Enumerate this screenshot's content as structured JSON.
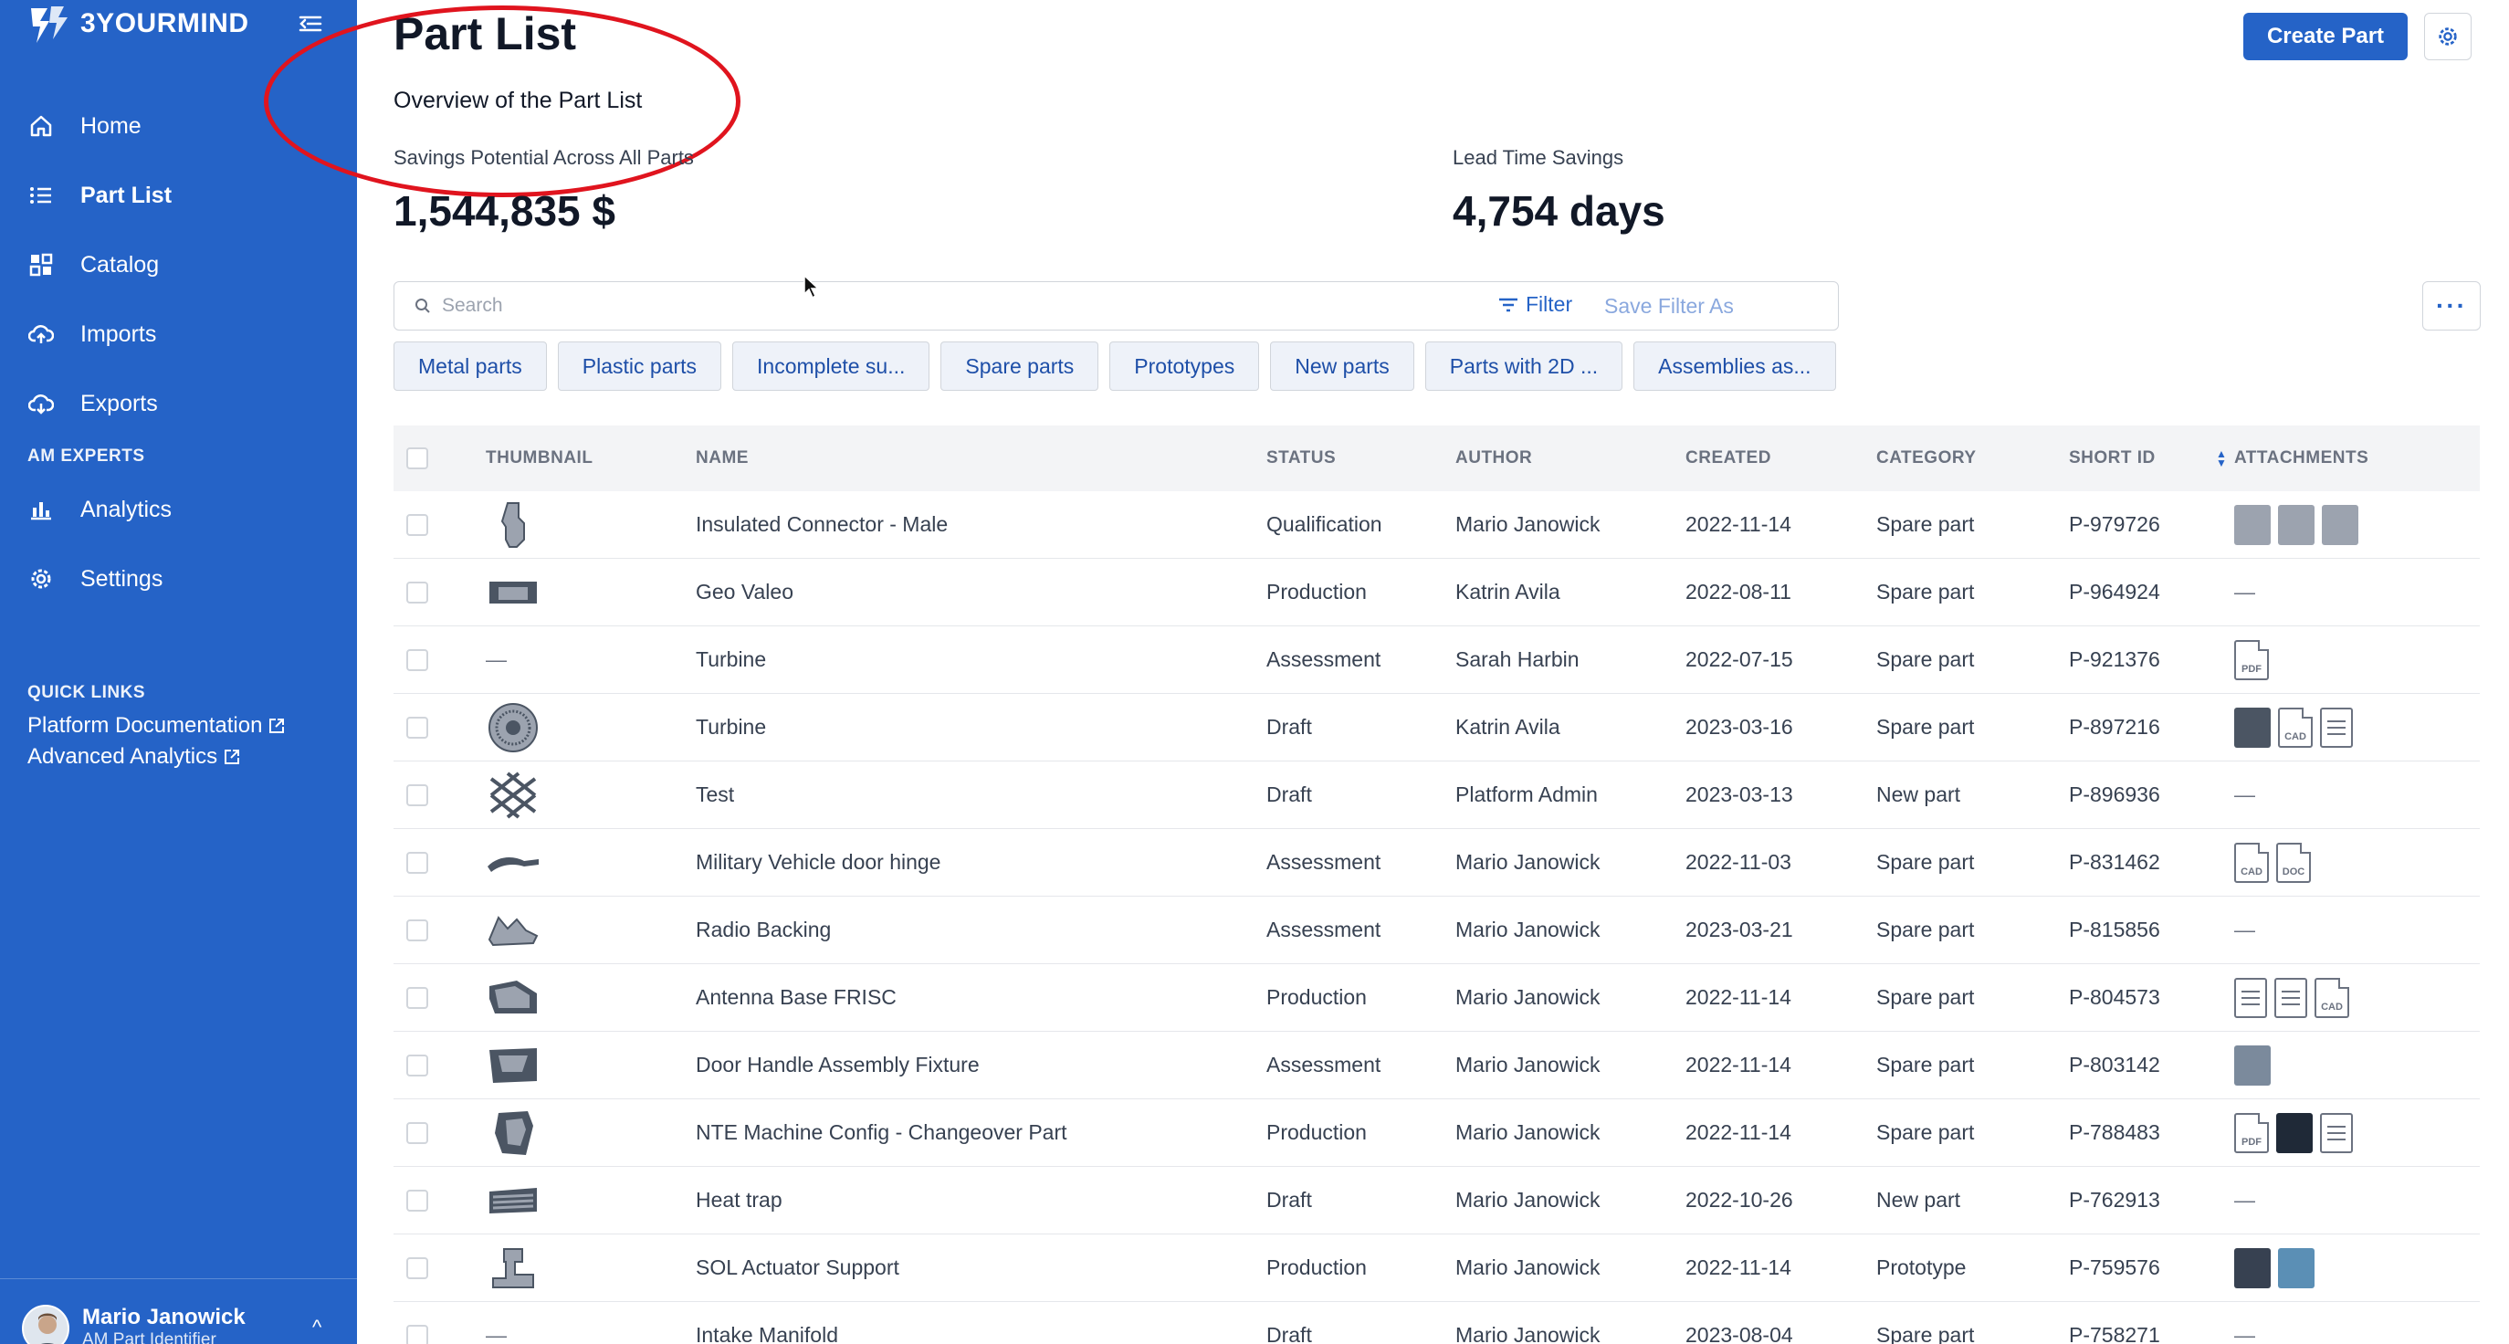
{
  "brand": {
    "name": "3YOURMIND"
  },
  "sidebar": {
    "items": [
      {
        "label": "Home",
        "icon": "home-icon"
      },
      {
        "label": "Part List",
        "icon": "list-icon",
        "active": true
      },
      {
        "label": "Catalog",
        "icon": "catalog-icon"
      },
      {
        "label": "Imports",
        "icon": "cloud-upload-icon"
      },
      {
        "label": "Exports",
        "icon": "cloud-download-icon"
      }
    ],
    "section_label": "AM EXPERTS",
    "expert_items": [
      {
        "label": "Analytics",
        "icon": "bar-chart-icon"
      },
      {
        "label": "Settings",
        "icon": "gear-icon"
      }
    ],
    "quick_links": {
      "title": "QUICK LINKS",
      "links": [
        "Platform Documentation",
        "Advanced Analytics"
      ]
    },
    "user": {
      "name": "Mario Janowick",
      "subtitle": "AM Part Identifier"
    }
  },
  "header": {
    "title": "Part List",
    "subtitle": "Overview of the Part List",
    "create_label": "Create Part"
  },
  "kpis": {
    "savings_label": "Savings Potential Across All Parts",
    "savings_value": "1,544,835 $",
    "lead_label": "Lead Time Savings",
    "lead_value": "4,754 days"
  },
  "search": {
    "placeholder": "Search"
  },
  "toolbar": {
    "filter_label": "Filter",
    "save_filter_label": "Save Filter As",
    "more_label": "···"
  },
  "chips": [
    "Metal parts",
    "Plastic parts",
    "Incomplete su...",
    "Spare parts",
    "Prototypes",
    "New parts",
    "Parts with 2D ...",
    "Assemblies as..."
  ],
  "table": {
    "columns": [
      "THUMBNAIL",
      "NAME",
      "STATUS",
      "AUTHOR",
      "CREATED",
      "CATEGORY",
      "SHORT ID",
      "ATTACHMENTS"
    ],
    "rows": [
      {
        "name": "Insulated Connector - Male",
        "status": "Qualification",
        "author": "Mario Janowick",
        "created": "2022-11-14",
        "category": "Spare part",
        "short_id": "P-979726",
        "thumb": "connector",
        "attachments": [
          "img-gray",
          "img-gray",
          "img-gray"
        ]
      },
      {
        "name": "Geo Valeo",
        "status": "Production",
        "author": "Katrin Avila",
        "created": "2022-08-11",
        "category": "Spare part",
        "short_id": "P-964924",
        "thumb": "block",
        "attachments": []
      },
      {
        "name": "Turbine",
        "status": "Assessment",
        "author": "Sarah Harbin",
        "created": "2022-07-15",
        "category": "Spare part",
        "short_id": "P-921376",
        "thumb": "none",
        "attachments": [
          "PDF"
        ]
      },
      {
        "name": "Turbine",
        "status": "Draft",
        "author": "Katrin Avila",
        "created": "2023-03-16",
        "category": "Spare part",
        "short_id": "P-897216",
        "thumb": "turbine",
        "attachments": [
          "img-dark",
          "CAD",
          "doc"
        ]
      },
      {
        "name": "Test",
        "status": "Draft",
        "author": "Platform Admin",
        "created": "2023-03-13",
        "category": "New part",
        "short_id": "P-896936",
        "thumb": "lattice",
        "attachments": []
      },
      {
        "name": "Military Vehicle door hinge",
        "status": "Assessment",
        "author": "Mario Janowick",
        "created": "2022-11-03",
        "category": "Spare part",
        "short_id": "P-831462",
        "thumb": "hinge",
        "attachments": [
          "CAD",
          "DOC"
        ]
      },
      {
        "name": "Radio Backing",
        "status": "Assessment",
        "author": "Mario Janowick",
        "created": "2023-03-21",
        "category": "Spare part",
        "short_id": "P-815856",
        "thumb": "backing",
        "attachments": []
      },
      {
        "name": "Antenna Base FRISC",
        "status": "Production",
        "author": "Mario Janowick",
        "created": "2022-11-14",
        "category": "Spare part",
        "short_id": "P-804573",
        "thumb": "antenna",
        "attachments": [
          "doc",
          "doc",
          "CAD"
        ]
      },
      {
        "name": "Door Handle Assembly Fixture",
        "status": "Assessment",
        "author": "Mario Janowick",
        "created": "2022-11-14",
        "category": "Spare part",
        "short_id": "P-803142",
        "thumb": "fixture",
        "attachments": [
          "img-photo"
        ]
      },
      {
        "name": "NTE Machine Config - Changeover Part",
        "status": "Production",
        "author": "Mario Janowick",
        "created": "2022-11-14",
        "category": "Spare part",
        "short_id": "P-788483",
        "thumb": "config",
        "attachments": [
          "PDF",
          "img-black",
          "doc"
        ]
      },
      {
        "name": "Heat trap",
        "status": "Draft",
        "author": "Mario Janowick",
        "created": "2022-10-26",
        "category": "New part",
        "short_id": "P-762913",
        "thumb": "heattrap",
        "attachments": []
      },
      {
        "name": "SOL Actuator Support",
        "status": "Production",
        "author": "Mario Janowick",
        "created": "2022-11-14",
        "category": "Prototype",
        "short_id": "P-759576",
        "thumb": "actuator",
        "attachments": [
          "img-small",
          "img-blue"
        ]
      },
      {
        "name": "Intake Manifold",
        "status": "Draft",
        "author": "Mario Janowick",
        "created": "2023-08-04",
        "category": "Spare part",
        "short_id": "P-758271",
        "thumb": "none",
        "attachments": []
      }
    ]
  },
  "colors": {
    "sidebar": "#2563c7",
    "accent": "#2563c7",
    "annotation": "#e0141e"
  }
}
